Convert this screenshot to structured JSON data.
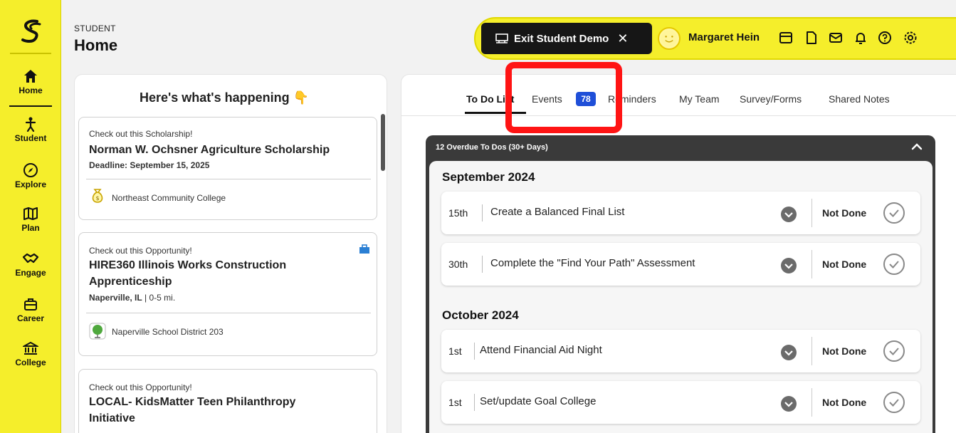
{
  "sidebar": {
    "items": [
      {
        "label": "Home",
        "icon": "home-icon"
      },
      {
        "label": "Student",
        "icon": "person-icon"
      },
      {
        "label": "Explore",
        "icon": "compass-icon"
      },
      {
        "label": "Plan",
        "icon": "map-icon"
      },
      {
        "label": "Engage",
        "icon": "handshake-icon"
      },
      {
        "label": "Career",
        "icon": "briefcase-icon"
      },
      {
        "label": "College",
        "icon": "bank-icon"
      }
    ]
  },
  "header": {
    "subtitle": "STUDENT",
    "title": "Home"
  },
  "topbar": {
    "exit_label": "Exit Student Demo",
    "user_name": "Margaret Hein"
  },
  "feed": {
    "title": "Here's what's happening",
    "cards": [
      {
        "kicker": "Check out this Scholarship!",
        "title": "Norman W. Ochsner Agriculture Scholarship",
        "meta_bold": "Deadline: September 15, 2025",
        "meta_rest": "",
        "org": "Northeast Community College"
      },
      {
        "kicker": "Check out this Opportunity!",
        "title": "HIRE360 Illinois Works Construction Apprenticeship",
        "meta_bold": "Naperville, IL",
        "meta_rest": " | 0-5 mi.",
        "org": "Naperville School District 203"
      },
      {
        "kicker": "Check out this Opportunity!",
        "title": "LOCAL- KidsMatter Teen Philanthropy Initiative"
      }
    ]
  },
  "tabs": [
    {
      "label": "To Do List"
    },
    {
      "label": "Events",
      "badge": "78"
    },
    {
      "label": "Reminders"
    },
    {
      "label": "My Team"
    },
    {
      "label": "Survey/Forms"
    },
    {
      "label": "Shared Notes"
    }
  ],
  "todo": {
    "header": "12 Overdue To Dos (30+ Days)",
    "months": [
      {
        "name": "September 2024",
        "items": [
          {
            "day": "15th",
            "task": "Create a Balanced Final List",
            "status": "Not Done"
          },
          {
            "day": "30th",
            "task": "Complete the \"Find Your Path\" Assessment",
            "status": "Not Done"
          }
        ]
      },
      {
        "name": "October 2024",
        "items": [
          {
            "day": "1st",
            "task": "Attend Financial Aid Night",
            "status": "Not Done"
          },
          {
            "day": "1st",
            "task": "Set/update Goal College",
            "status": "Not Done"
          }
        ]
      }
    ]
  },
  "colors": {
    "brand_yellow": "#f5ee2b",
    "badge_blue": "#1f4fd8",
    "highlight_red": "#ff1414"
  }
}
